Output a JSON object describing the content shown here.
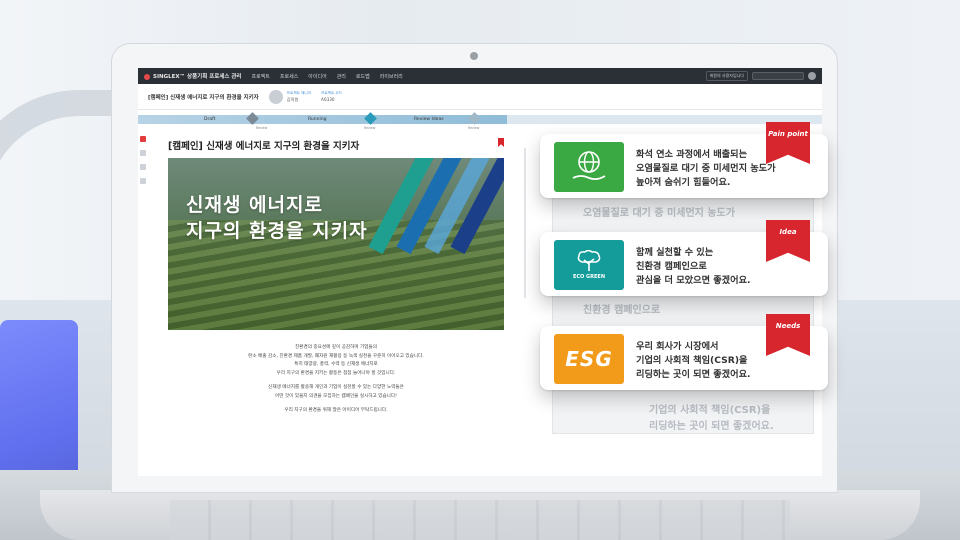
{
  "app": {
    "logo": "SINGLEX™ 상품기획 프로세스 관리",
    "nav": [
      "프로젝트",
      "프로세스",
      "아이디어",
      "관리",
      "로드맵",
      "라이브러리"
    ],
    "top_right_button": "위원의 사용자입니다"
  },
  "header": {
    "title": "[캠페인] 신재생 에너지로 지구의 환경을 지키자",
    "author_label": "프로젝트 매니저",
    "author_name": "김직원",
    "project_label": "프로젝트 코드",
    "project_value": "A0330"
  },
  "stages": {
    "progress": 0.54,
    "items": [
      {
        "label": "Draft"
      },
      {
        "label": "Running"
      },
      {
        "label": "Review Ideas"
      }
    ],
    "dates": [
      "Review",
      "Review",
      "Review"
    ]
  },
  "campaign": {
    "title": "[캠페인] 신재생 에너지로 지구의 환경을 지키자",
    "hero_line1": "신재생 에너지로",
    "hero_line2": "지구의 환경을 지키자",
    "body": [
      "친환경의 중요성에 깊이 공감하며 기업들의",
      "탄소 배출 감소, 친환경 제품 개발, 폐자원 재활용 등 녹색 실천을 꾸준히 이어오고 있습니다.",
      "특히 태양광, 풍력, 수력 등 신재생 에너지로",
      "우리 지구의 환경을 지키는 활동은 점점 늘어나야 할 것입니다.",
      "신재생 에너지를 활용해 개인과 기업이 실천할 수 있는 다양한 노력들은",
      "어떤 것이 있을지 의견을 모집하는 캠페인을 실시하고 있습니다!",
      "우리 지구의 환경을 위해 많은 아이디어 부탁드립니다."
    ]
  },
  "panel": {
    "ghost_lines": [
      "오염물질로 대기 중 미세먼지 농도가",
      "친환경 캠페인으로",
      "기업의 사회적 책임(CSR)을",
      "리딩하는 곳이 되면 좋겠어요."
    ]
  },
  "cards": [
    {
      "tag": "Pain point",
      "lines": [
        "화석 연소 과정에서 배출되는",
        "오염물질로 대기 중 미세먼지 농도가",
        "높아져 숨쉬기 힘들어요."
      ],
      "icon": "globe-hand-icon",
      "color": "#3aa843"
    },
    {
      "tag": "Idea",
      "lines": [
        "함께 실천할 수 있는",
        "친환경 캠페인으로",
        "관심을 더 모았으면 좋겠어요."
      ],
      "icon": "eco-green-tree-icon",
      "tile_text": "ECO GREEN",
      "color": "#139c9a"
    },
    {
      "tag": "Needs",
      "lines": [
        "우리 회사가 시장에서",
        "기업의 사회적 책임(CSR)을",
        "리딩하는 곳이 되면 좋겠어요."
      ],
      "icon": "esg-badge-icon",
      "tile_text": "ESG",
      "color": "#f29a1a"
    }
  ],
  "colors": {
    "accent_red": "#d7262e",
    "topbar": "#2b2f36",
    "stage_teal": "#2a9bb8"
  }
}
